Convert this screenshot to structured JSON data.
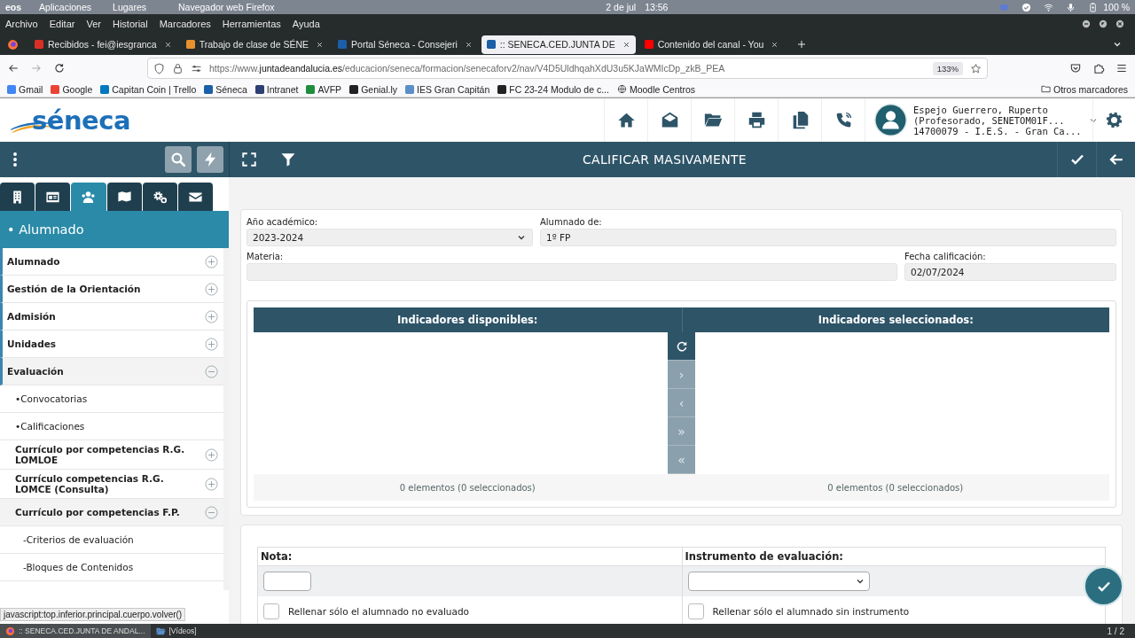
{
  "desktop": {
    "logo": "eos",
    "menus": [
      "Aplicaciones",
      "Lugares"
    ],
    "app": "Navegador web Firefox",
    "date": "2 de jul",
    "time": "13:56",
    "battery": "100 %"
  },
  "browser": {
    "menu": [
      "Archivo",
      "Editar",
      "Ver",
      "Historial",
      "Marcadores",
      "Herramientas",
      "Ayuda"
    ],
    "tabs": [
      {
        "title": "Recibidos - fei@iesgranca",
        "color": "#d93025",
        "selected": false
      },
      {
        "title": "Trabajo de clase de SÉNE",
        "color": "#e8912d",
        "selected": false
      },
      {
        "title": "Portal Séneca - Consejeri",
        "color": "#1a5fa8",
        "selected": false
      },
      {
        "title": ":: SENECA.CED.JUNTA DE",
        "color": "#1a5fa8",
        "selected": true
      },
      {
        "title": "Contenido del canal - You",
        "color": "#ff0000",
        "selected": false
      }
    ],
    "url": {
      "prefix": "https://www.",
      "domain": "juntadeandalucia.es",
      "path": "/educacion/seneca/formacion/senecaforv2/nav/V4D5UldhqahXdU3u5KJaWMIcDp_zkB_PEA"
    },
    "zoom": "133%",
    "bookmarks": [
      {
        "label": "Gmail",
        "kind": "favicon",
        "color": "#4285f4"
      },
      {
        "label": "Google",
        "kind": "favicon",
        "color": "#ea4335"
      },
      {
        "label": "Capitan Coin | Trello",
        "kind": "favicon",
        "color": "#0079bf"
      },
      {
        "label": "Séneca",
        "kind": "favicon",
        "color": "#1a5fa8"
      },
      {
        "label": "Intranet",
        "kind": "favicon",
        "color": "#2c3e73"
      },
      {
        "label": "AVFP",
        "kind": "favicon",
        "color": "#1e8e3e"
      },
      {
        "label": "Genial.ly",
        "kind": "favicon",
        "color": "#222222"
      },
      {
        "label": "IES Gran Capitán",
        "kind": "favicon",
        "color": "#5b8fc7"
      },
      {
        "label": "FC 23-24 Modulo de c...",
        "kind": "favicon",
        "color": "#222222"
      },
      {
        "label": "Moodle Centros",
        "kind": "globe"
      }
    ],
    "other_bookmarks": "Otros marcadores",
    "status_link": "javascript:top.inferior.principal.cuerpo.volver()"
  },
  "app": {
    "logo": "séneca",
    "toolbar": [
      {
        "kind": "home"
      },
      {
        "kind": "mailopen"
      },
      {
        "kind": "folder"
      },
      {
        "kind": "printer"
      },
      {
        "kind": "copy"
      },
      {
        "kind": "phone"
      }
    ],
    "user": {
      "name": "Espejo Guerrero, Ruperto",
      "role": "(Profesorado, SENETOM01F...",
      "center": "14700079 - I.E.S. - Gran Ca..."
    },
    "title": "CALIFICAR MASIVAMENTE"
  },
  "sidebar": {
    "tabs": [
      {
        "kind": "building",
        "selected": false
      },
      {
        "kind": "idcard",
        "selected": false
      },
      {
        "kind": "users",
        "selected": true
      },
      {
        "kind": "book",
        "selected": false
      },
      {
        "kind": "gears",
        "selected": false
      },
      {
        "kind": "envelope",
        "selected": false
      }
    ],
    "heading": "• Alumnado",
    "menu": [
      {
        "label": "Alumnado",
        "expanded": false
      },
      {
        "label": "Gestión de la Orientación",
        "expanded": false
      },
      {
        "label": "Admisión",
        "expanded": false
      },
      {
        "label": "Unidades",
        "expanded": false
      },
      {
        "label": "Evaluación",
        "expanded": true,
        "children": [
          {
            "label": "•Convocatorias"
          },
          {
            "label": "•Calificaciones"
          },
          {
            "label": "Currículo por competencias R.G. LOMLOE",
            "expanded": false
          },
          {
            "label": "Currículo competencias R.G. LOMCE (Consulta)",
            "expanded": false
          },
          {
            "label": "Currículo por competencias F.P.",
            "expanded": true,
            "children": [
              {
                "label": "-Criterios de evaluación"
              },
              {
                "label": "-Bloques de Contenidos"
              }
            ]
          }
        ]
      }
    ]
  },
  "form": {
    "fields": [
      {
        "label": "Año académico:",
        "kind": "select",
        "value": "2023-2024"
      },
      {
        "label": "Alumnado de:",
        "kind": "text",
        "value": "1º FP"
      },
      {
        "label": "Materia:",
        "kind": "text"
      },
      {
        "label": "Fecha calificación:",
        "kind": "text",
        "value": "02/07/2024"
      }
    ]
  },
  "transfer": {
    "available_title": "Indicadores disponibles:",
    "selected_title": "Indicadores seleccionados:",
    "buttons": [
      {
        "kind": "refresh",
        "disabled": false
      },
      {
        "kind": "move",
        "label": "›",
        "disabled": true
      },
      {
        "kind": "move",
        "label": "‹",
        "disabled": true
      },
      {
        "kind": "move",
        "label": "»",
        "disabled": true
      },
      {
        "kind": "move",
        "label": "«",
        "disabled": true
      }
    ],
    "available_count": "0 elementos (0 seleccionados)",
    "selected_count": "0 elementos (0 seleccionados)"
  },
  "grading": {
    "columns": [
      {
        "label": "Nota:",
        "kind": "input"
      },
      {
        "label": "Instrumento de evaluación:",
        "kind": "select"
      }
    ],
    "options": [
      {
        "label": "Rellenar sólo el alumnado no evaluado",
        "checked": false
      },
      {
        "label": "Rellenar sólo el alumnado sin instrumento",
        "checked": false
      }
    ]
  },
  "taskbar": {
    "tasks": [
      {
        "label": ":: SENECA.CED.JUNTA DE ANDAL...",
        "kind": "browser",
        "selected": true
      },
      {
        "label": "[Vídeos]",
        "kind": "folder",
        "selected": false
      }
    ],
    "workspace": "1 / 2"
  }
}
